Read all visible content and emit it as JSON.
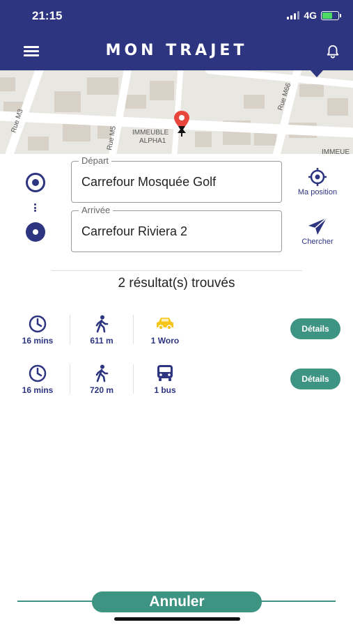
{
  "status_bar": {
    "time": "21:15",
    "network": "4G"
  },
  "header": {
    "title": "MON TRAJET"
  },
  "map": {
    "labels": [
      "Rue M3",
      "Rue M5",
      "Rue M66",
      "IMMEUBLE",
      "ALPHA1",
      "IMMEUE"
    ]
  },
  "form": {
    "depart": {
      "legend": "Départ",
      "value": "Carrefour Mosquée Golf"
    },
    "arrivee": {
      "legend": "Arrivée",
      "value": "Carrefour Riviera 2"
    },
    "my_position_label": "Ma position",
    "search_label": "Chercher"
  },
  "results": {
    "count_text": "2 résultat(s) trouvés",
    "items": [
      {
        "duration": "16 mins",
        "walk": "611 m",
        "transport": "1 Woro",
        "transport_icon": "car-icon",
        "details_label": "Détails"
      },
      {
        "duration": "16 mins",
        "walk": "720 m",
        "transport": "1 bus",
        "transport_icon": "bus-icon",
        "details_label": "Détails"
      }
    ]
  },
  "footer": {
    "cancel_label": "Annuler"
  },
  "colors": {
    "primary": "#2d3480",
    "accent": "#3d9482",
    "taxi": "#f5c518",
    "pin": "#e8463c"
  }
}
